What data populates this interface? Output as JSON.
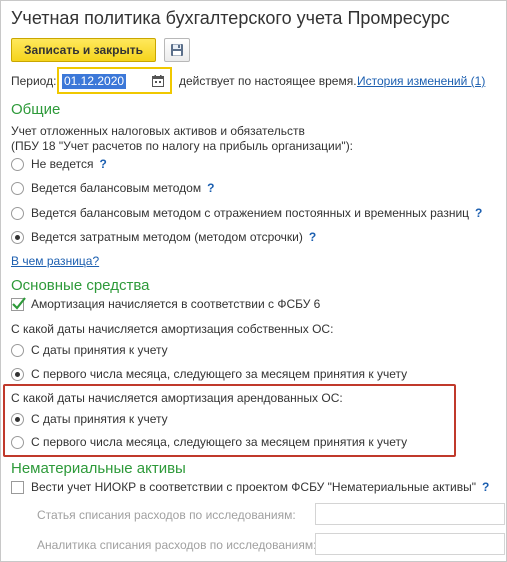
{
  "title": "Учетная политика бухгалтерского учета Промресурс",
  "toolbar": {
    "write_close_label": "Записать и закрыть",
    "save_icon": "floppy-disk-icon"
  },
  "period": {
    "label": "Период:",
    "value": "01.12.2020",
    "calendar_icon": "calendar-icon",
    "status": "действует по настоящее время.",
    "history_link": "История изменений (1)"
  },
  "general": {
    "heading": "Общие",
    "description_line1": "Учет отложенных налоговых активов и обязательств",
    "description_line2": "(ПБУ 18 \"Учет расчетов по налогу на прибыль организации\"):",
    "options": [
      {
        "label": "Не ведется",
        "selected": false,
        "help": "?"
      },
      {
        "label": "Ведется балансовым методом",
        "selected": false,
        "help": "?"
      },
      {
        "label": "Ведется балансовым методом с отражением постоянных и временных разниц",
        "selected": false,
        "help": "?"
      },
      {
        "label": "Ведется затратным методом (методом отсрочки)",
        "selected": true,
        "help": "?"
      }
    ],
    "difference_link": "В чем разница?"
  },
  "fixed_assets": {
    "heading": "Основные средства",
    "fsbu6_checkbox": {
      "label": "Амортизация начисляется в соответствии с ФСБУ 6",
      "checked": true
    },
    "own_question": "С какой даты начисляется амортизация собственных ОС:",
    "own_options": [
      {
        "label": "С даты принятия к учету",
        "selected": false
      },
      {
        "label": "С первого числа месяца, следующего за месяцем принятия к учету",
        "selected": true
      }
    ],
    "leased_question": "С какой даты начисляется амортизация арендованных ОС:",
    "leased_options": [
      {
        "label": "С даты принятия к учету",
        "selected": true
      },
      {
        "label": "С первого числа месяца, следующего за месяцем принятия к учету",
        "selected": false
      }
    ],
    "highlight_color": "#c0392b"
  },
  "intangibles": {
    "heading": "Нематериальные активы",
    "niokr_checkbox": {
      "label": "Вести учет НИОКР в соответствии с проектом ФСБУ \"Нематериальные активы\"",
      "checked": false,
      "help": "?"
    },
    "research_expense_label": "Статья списания расходов по исследованиям:",
    "research_analytics_label": "Аналитика списания расходов по исследованиям:"
  },
  "colors": {
    "section_heading": "#2e9a3a",
    "link": "#1c5fb0",
    "primary_button": "#f5d41c",
    "period_border": "#f0c800"
  }
}
